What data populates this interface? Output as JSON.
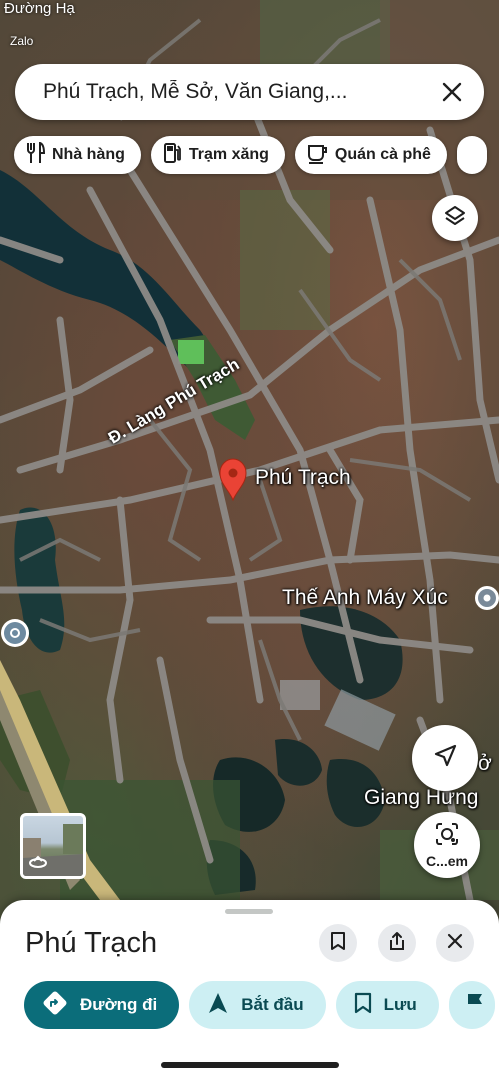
{
  "status_bar": {
    "top_text": "Đường Hạ",
    "app_hint": "Zalo"
  },
  "search": {
    "query": "Phú Trạch, Mễ Sở, Văn Giang,..."
  },
  "chips": [
    {
      "label": "Nhà hàng",
      "icon": "restaurant-icon"
    },
    {
      "label": "Trạm xăng",
      "icon": "gas-station-icon"
    },
    {
      "label": "Quán cà phê",
      "icon": "coffee-icon"
    }
  ],
  "map": {
    "road_label": "Đ. Làng Phú Trạch",
    "pin_label": "Phú Trạch",
    "poi_label": "Thế Anh Máy Xúc",
    "right_label": "Giang Hưng",
    "right_label_partial": "ở"
  },
  "lens_button": {
    "label": "C...em"
  },
  "sheet": {
    "title": "Phú Trạch",
    "actions": [
      {
        "label": "Đường đi",
        "icon": "directions-icon",
        "style": "primary"
      },
      {
        "label": "Bắt đầu",
        "icon": "navigation-arrow-icon",
        "style": "tonal"
      },
      {
        "label": "Lưu",
        "icon": "bookmark-icon",
        "style": "tonal"
      }
    ]
  },
  "colors": {
    "primary": "#0b6d7a",
    "tonal": "#cdeff3",
    "pin": "#ea4335"
  }
}
